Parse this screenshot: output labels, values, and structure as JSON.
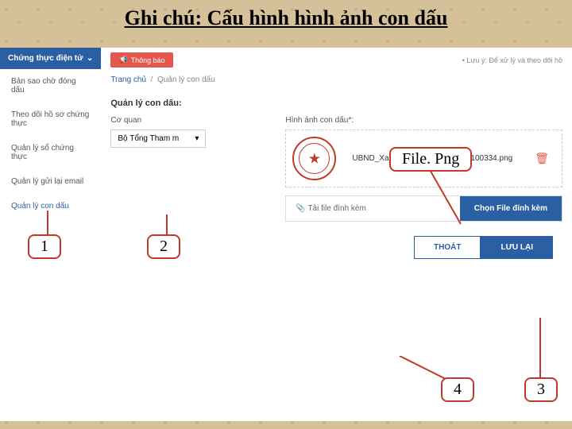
{
  "slide": {
    "title": "Ghi chú: Cấu hình hình ảnh con dấu"
  },
  "sidebar": {
    "header": "Chứng thực điện tử",
    "items": [
      {
        "label": "Bản sao chờ đóng dấu"
      },
      {
        "label": "Theo dõi hồ sơ chứng thực"
      },
      {
        "label": "Quản lý sổ chứng thực"
      },
      {
        "label": "Quản lý gửi lại email"
      },
      {
        "label": "Quản lý con dấu"
      }
    ]
  },
  "topbar": {
    "notif": "Thông báo",
    "note": "Lưu ý: Để xử lý và theo dõi hồ"
  },
  "breadcrumb": {
    "home": "Trang chủ",
    "current": "Quản lý con dấu"
  },
  "form": {
    "section": "Quản lý con dấu:",
    "org_label": "Cơ quan",
    "org_value": "Bộ Tổng Tham m",
    "img_label": "Hình ảnh con dấu*:",
    "filename": "UBND_Xa_PhuCuong_20200629100334.png",
    "attach_label": "Tải file đính kèm",
    "attach_btn": "Chọn File đính kèm"
  },
  "actions": {
    "exit": "THOÁT",
    "save": "LƯU LẠI"
  },
  "callouts": {
    "filepng": "File. Png",
    "c1": "1",
    "c2": "2",
    "c3": "3",
    "c4": "4"
  }
}
